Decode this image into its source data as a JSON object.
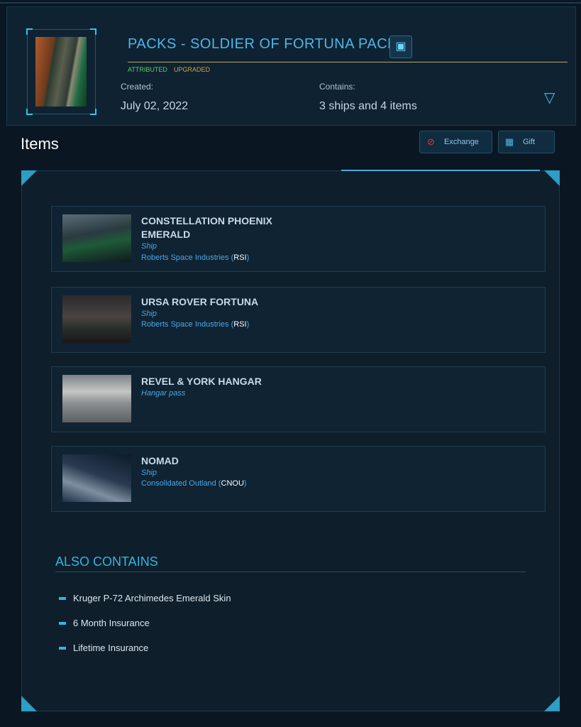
{
  "pack": {
    "title": "PACKS - SOLDIER OF FORTUNA PACK",
    "attributed": "ATTRIBUTED",
    "upgraded": "UPGRADED",
    "chip_icon": "chip-icon",
    "created_label": "Created:",
    "created_value": "July 02, 2022",
    "contains_label": "Contains:",
    "contains_value": "3 ships and 4 items",
    "expand_icon": "triangle-down-icon"
  },
  "items_section": {
    "title": "Items",
    "exchange_label": "Exchange",
    "gift_label": "Gift",
    "exchange_icon": "no-entry-icon",
    "gift_icon": "gift-icon"
  },
  "items": [
    {
      "name": "CONSTELLATION PHOENIX EMERALD",
      "type": "Ship",
      "maker": "Roberts Space Industries",
      "code": "RSI"
    },
    {
      "name": "URSA ROVER FORTUNA",
      "type": "Ship",
      "maker": "Roberts Space Industries",
      "code": "RSI"
    },
    {
      "name": "REVEL & YORK HANGAR",
      "type": "Hangar pass"
    },
    {
      "name": "NOMAD",
      "type": "Ship",
      "maker": "Consolidated Outland",
      "code": "CNOU"
    }
  ],
  "also_contains": {
    "title": "ALSO CONTAINS",
    "items": [
      "Kruger P-72 Archimedes Emerald Skin",
      "6 Month Insurance",
      "Lifetime Insurance"
    ]
  },
  "colors": {
    "accent": "#33c4e6",
    "attributed": "#57d25a",
    "upgraded": "#d6a13a",
    "background": "#0a1722"
  }
}
